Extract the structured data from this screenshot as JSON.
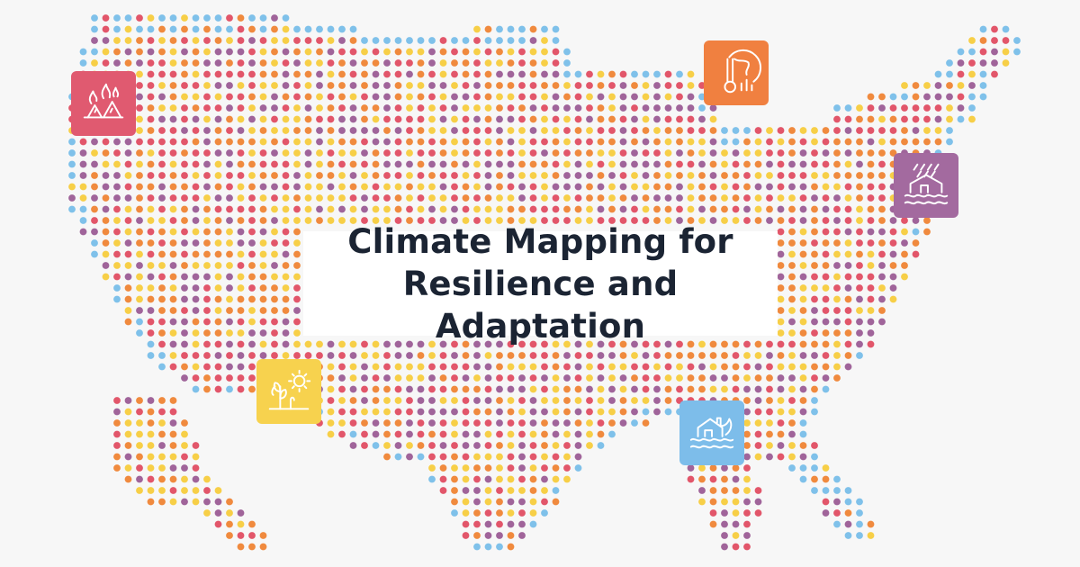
{
  "title": {
    "line1": "Climate Mapping for",
    "line2": "Resilience and Adaptation"
  },
  "map": {
    "region": "contiguous United States",
    "dot_palette": [
      "#e2566a",
      "#f08a3e",
      "#f7cf47",
      "#a0649a",
      "#7fc1ea"
    ]
  },
  "hazard_icons": [
    {
      "key": "wildfire",
      "icon": "wildfire-icon",
      "color": "#e05a70"
    },
    {
      "key": "extreme-heat",
      "icon": "globe-thermometer-icon",
      "color": "#f08040"
    },
    {
      "key": "inland-flooding",
      "icon": "house-rain-flood-icon",
      "color": "#a36a9f"
    },
    {
      "key": "drought",
      "icon": "sun-wilting-plant-icon",
      "color": "#f7d24e"
    },
    {
      "key": "coastal-flooding",
      "icon": "house-waves-icon",
      "color": "#7dbdea"
    }
  ]
}
